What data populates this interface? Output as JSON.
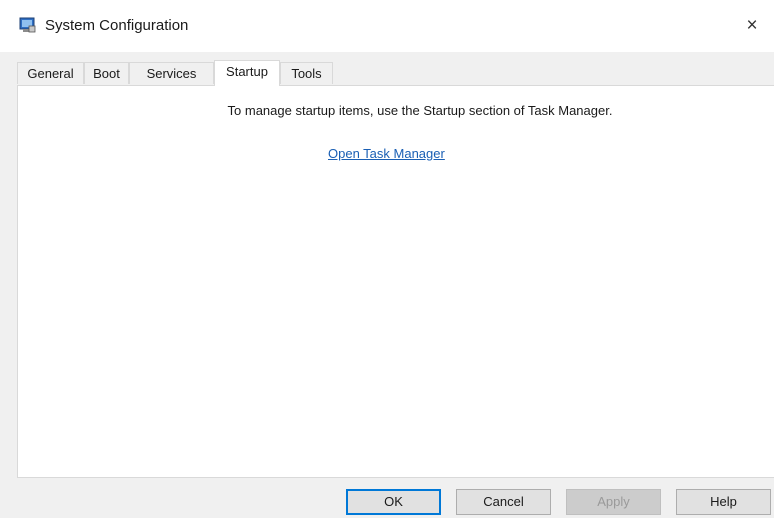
{
  "window": {
    "title": "System Configuration",
    "close_glyph": "×",
    "icon": "system-configuration-icon"
  },
  "tabs": [
    {
      "label": "General",
      "active": false
    },
    {
      "label": "Boot",
      "active": false
    },
    {
      "label": "Services",
      "active": false
    },
    {
      "label": "Startup",
      "active": true
    },
    {
      "label": "Tools",
      "active": false
    }
  ],
  "startup_panel": {
    "message": "To manage startup items, use the Startup section of Task Manager.",
    "link_label": "Open Task Manager"
  },
  "buttons": {
    "ok": "OK",
    "cancel": "Cancel",
    "apply": "Apply",
    "help": "Help"
  },
  "colors": {
    "link": "#1a5fb4",
    "default_button_border": "#0078d7"
  }
}
